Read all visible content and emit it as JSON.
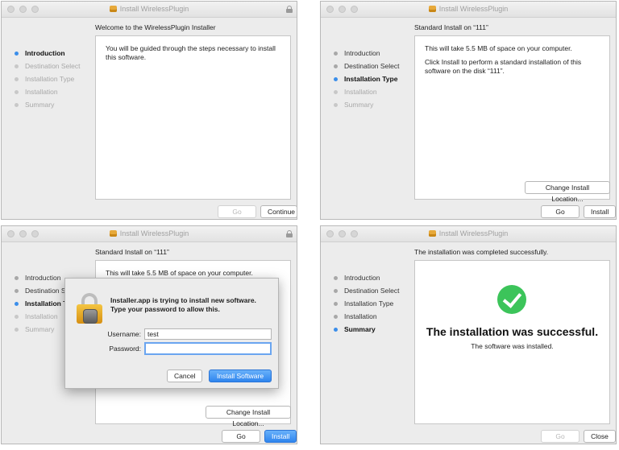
{
  "window_title": "Install WirelessPlugin",
  "steps": [
    "Introduction",
    "Destination Select",
    "Installation Type",
    "Installation",
    "Summary"
  ],
  "win1": {
    "header": "Welcome to the WirelessPlugin Installer",
    "text": "You will be guided through the steps necessary to install this software.",
    "back_label": "Go Back",
    "continue_label": "Continue"
  },
  "win2": {
    "header": "Standard Install on “111”",
    "text1": "This will take 5.5 MB of space on your computer.",
    "text2": "Click Install to perform a standard installation of this software on the disk “111”.",
    "change_label": "Change Install Location...",
    "back_label": "Go Back",
    "install_label": "Install"
  },
  "win3": {
    "header": "Standard Install on “111”",
    "text1": "This will take 5.5 MB of space on your computer.",
    "change_label": "Change Install Location...",
    "back_label": "Go Back",
    "install_label": "Install",
    "dialog": {
      "title": "Installer.app is trying to install new software. Type your password to allow this.",
      "username_label": "Username:",
      "username_value": "test",
      "password_label": "Password:",
      "password_value": "",
      "cancel_label": "Cancel",
      "install_software_label": "Install Software"
    }
  },
  "win4": {
    "header": "The installation was completed successfully.",
    "big_text": "The installation was successful.",
    "small_text": "The software was installed.",
    "back_label": "Go Back",
    "close_label": "Close"
  },
  "colors": {
    "accent": "#3b8eea",
    "success": "#3cc45a",
    "lock": "#e7a93a"
  },
  "icons": [
    "package-icon",
    "lock-icon",
    "checkmark-icon"
  ]
}
